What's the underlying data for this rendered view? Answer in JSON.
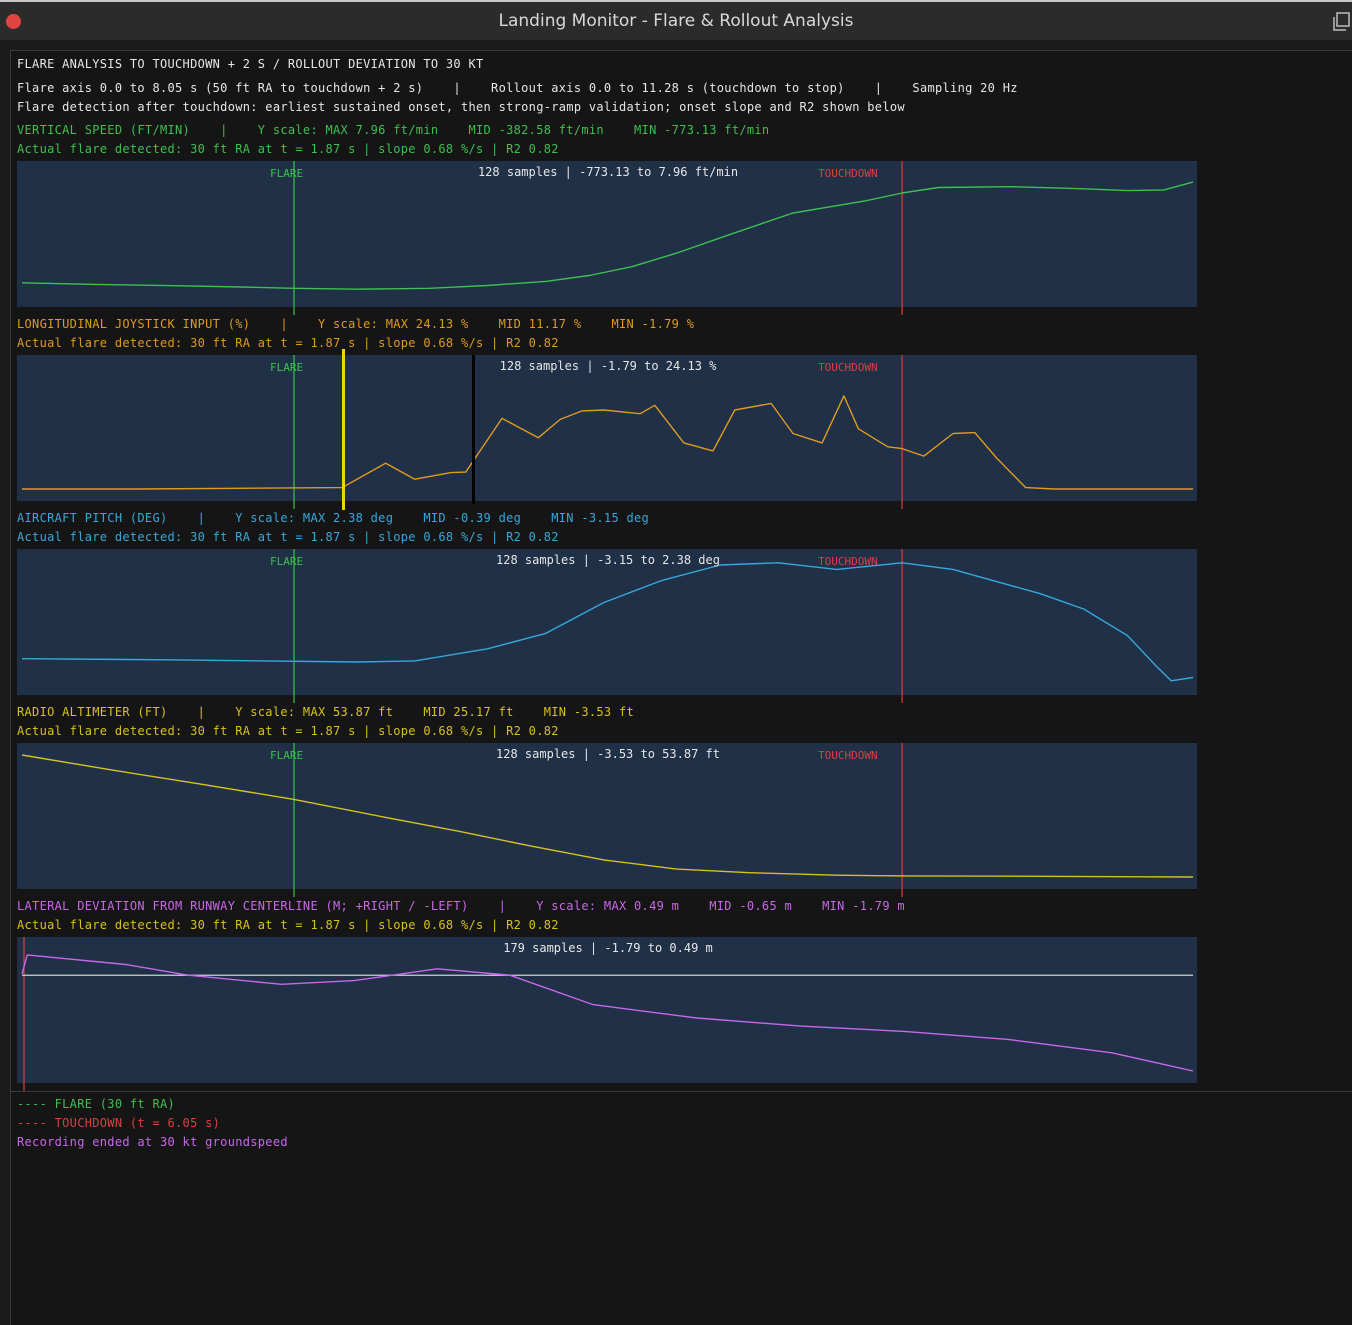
{
  "window": {
    "title": "Landing Monitor - Flare & Rollout Analysis"
  },
  "header": {
    "line1": "FLARE ANALYSIS TO TOUCHDOWN + 2 S / ROLLOUT DEVIATION TO 30 KT",
    "line2": "Flare axis 0.0 to 8.05 s (50 ft RA to touchdown + 2 s)    |    Rollout axis 0.0 to 11.28 s (touchdown to stop)    |    Sampling 20 Hz",
    "line3": "Flare detection after touchdown: earliest sustained onset, then strong-ramp validation; onset slope and R2 shown below"
  },
  "colors": {
    "vertical_speed": "#3fbf4f",
    "joystick": "#e09a1e",
    "pitch": "#36a8dc",
    "radio_altimeter": "#d6c21e",
    "lateral": "#c768e8",
    "flare_marker": "#3fbf4f",
    "touchdown_marker": "#d94040",
    "panel_bg": "#1f3047"
  },
  "marker_labels": {
    "flare": "FLARE",
    "touchdown": "TOUCHDOWN"
  },
  "chart_data": [
    {
      "type": "line",
      "title": "VERTICAL SPEED (FT/MIN)    |    Y scale: MAX 7.96 ft/min    MID -382.58 ft/min    MIN -773.13 ft/min",
      "detection": "Actual flare detected: 30 ft RA at t = 1.87 s | slope 0.68 %/s | R2 0.82",
      "summary": "128 samples | -773.13 to 7.96 ft/min",
      "ylim": [
        -773.13,
        7.96
      ],
      "xlim": [
        0,
        8.05
      ],
      "flare_t": 1.87,
      "touchdown_t": 6.05,
      "x": [
        0,
        0.5,
        1.0,
        1.5,
        1.87,
        2.3,
        2.8,
        3.2,
        3.6,
        3.9,
        4.2,
        4.5,
        4.9,
        5.3,
        5.8,
        6.05,
        6.3,
        6.8,
        7.3,
        7.6,
        7.85,
        8.05
      ],
      "values": [
        -695,
        -705,
        -713,
        -722,
        -730,
        -736,
        -730,
        -712,
        -686,
        -648,
        -590,
        -505,
        -375,
        -248,
        -170,
        -120,
        -85,
        -80,
        -93,
        -105,
        -100,
        -50
      ]
    },
    {
      "type": "line",
      "title": "LONGITUDINAL JOYSTICK INPUT (%)    |    Y scale: MAX 24.13 %    MID 11.17 %    MIN -1.79 %",
      "detection": "Actual flare detected: 30 ft RA at t = 1.87 s | slope 0.68 %/s | R2 0.82",
      "summary": "128 samples | -1.79 to 24.13 %",
      "ylim": [
        -1.79,
        24.13
      ],
      "xlim": [
        0,
        8.05
      ],
      "flare_t": 1.87,
      "touchdown_t": 6.05,
      "x": [
        0,
        0.8,
        2.2,
        2.5,
        2.7,
        2.95,
        3.05,
        3.3,
        3.55,
        3.7,
        3.85,
        4.0,
        4.25,
        4.35,
        4.55,
        4.75,
        4.9,
        5.15,
        5.3,
        5.5,
        5.65,
        5.75,
        5.95,
        6.05,
        6.2,
        6.4,
        6.55,
        6.7,
        6.9,
        7.1,
        8.05
      ],
      "values": [
        -1.79,
        -1.79,
        -1.5,
        3.7,
        0.3,
        1.7,
        1.8,
        13.2,
        9.1,
        13.0,
        14.8,
        15.0,
        14.2,
        16.0,
        8.0,
        6.3,
        15.0,
        16.4,
        10.0,
        8.0,
        18.0,
        11.0,
        7.2,
        6.8,
        5.2,
        10.0,
        10.2,
        4.8,
        -1.5,
        -1.79,
        -1.79
      ]
    },
    {
      "type": "line",
      "title": "AIRCRAFT PITCH (DEG)    |    Y scale: MAX 2.38 deg    MID -0.39 deg    MIN -3.15 deg",
      "detection": "Actual flare detected: 30 ft RA at t = 1.87 s | slope 0.68 %/s | R2 0.82",
      "summary": "128 samples | -3.15 to 2.38 deg",
      "ylim": [
        -3.15,
        2.38
      ],
      "xlim": [
        0,
        8.05
      ],
      "flare_t": 1.87,
      "touchdown_t": 6.05,
      "x": [
        0,
        1.0,
        2.3,
        2.7,
        3.2,
        3.6,
        4.0,
        4.4,
        4.8,
        5.2,
        5.6,
        6.05,
        6.4,
        7.0,
        7.3,
        7.6,
        7.8,
        7.9,
        8.05
      ],
      "values": [
        -2.05,
        -2.1,
        -2.2,
        -2.15,
        -1.6,
        -0.9,
        0.5,
        1.5,
        2.2,
        2.3,
        2.0,
        2.3,
        2.0,
        0.9,
        0.2,
        -1.0,
        -2.4,
        -3.05,
        -2.9
      ]
    },
    {
      "type": "line",
      "title": "RADIO ALTIMETER (FT)    |    Y scale: MAX 53.87 ft    MID 25.17 ft    MIN -3.53 ft",
      "detection": "Actual flare detected: 30 ft RA at t = 1.87 s | slope 0.68 %/s | R2 0.82",
      "summary": "128 samples | -3.53 to 53.87 ft",
      "ylim": [
        -3.53,
        53.87
      ],
      "xlim": [
        0,
        8.05
      ],
      "flare_t": 1.87,
      "touchdown_t": 6.05,
      "x": [
        0,
        0.6,
        1.2,
        1.87,
        2.5,
        3.0,
        3.5,
        4.0,
        4.5,
        5.0,
        5.6,
        6.05,
        7.0,
        8.05
      ],
      "values": [
        53.87,
        47.0,
        40.5,
        33.0,
        24.5,
        18.0,
        11.0,
        4.5,
        0.2,
        -1.5,
        -2.7,
        -3.0,
        -3.2,
        -3.53
      ]
    },
    {
      "type": "line",
      "title": "LATERAL DEVIATION FROM RUNWAY CENTERLINE (M; +RIGHT / -LEFT)    |    Y scale: MAX 0.49 m    MID -0.65 m    MIN -1.79 m",
      "detection": "Actual flare detected: 30 ft RA at t = 1.87 s | slope 0.68 %/s | R2 0.82",
      "summary": "179 samples | -1.79 to 0.49 m",
      "ylim": [
        -1.79,
        0.49
      ],
      "xlim": [
        0,
        11.28
      ],
      "touchdown_t": 0,
      "zero_line": 0,
      "x": [
        0,
        0.05,
        1.0,
        1.6,
        2.5,
        3.2,
        4.0,
        4.7,
        5.5,
        6.5,
        7.5,
        8.5,
        9.5,
        10.5,
        11.28
      ],
      "values": [
        0.02,
        0.38,
        0.2,
        0.0,
        -0.17,
        -0.1,
        0.12,
        0.0,
        -0.55,
        -0.8,
        -0.95,
        -1.05,
        -1.2,
        -1.45,
        -1.79
      ]
    }
  ],
  "legend": {
    "flare": "---- FLARE (30 ft RA)",
    "touchdown": "---- TOUCHDOWN (t = 6.05 s)",
    "recording": "Recording ended at 30 kt groundspeed"
  }
}
